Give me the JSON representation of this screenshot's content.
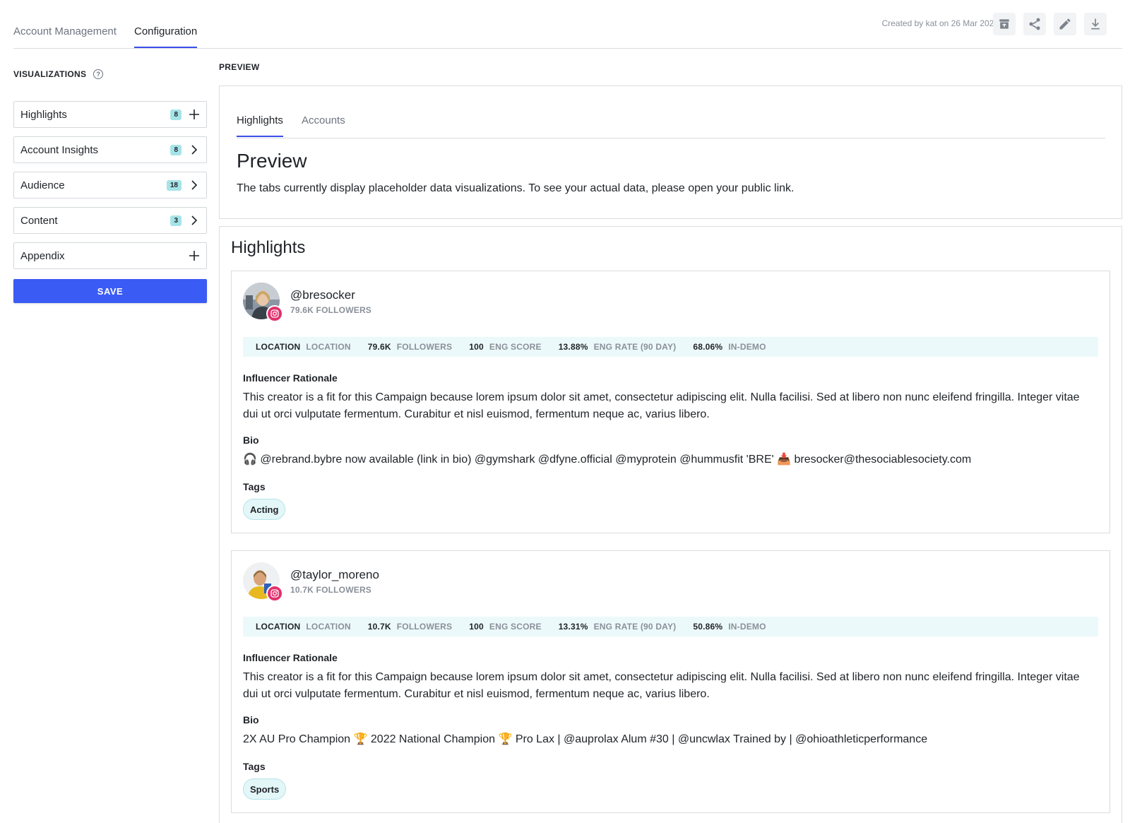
{
  "header": {
    "tabs": [
      {
        "label": "Account Management"
      },
      {
        "label": "Configuration"
      }
    ],
    "created_text": "Created by kat on 26 Mar 2025",
    "tools": [
      "archive-icon",
      "share-icon",
      "edit-icon",
      "download-icon"
    ]
  },
  "sidebar": {
    "title": "VISUALIZATIONS",
    "help": "?",
    "items": [
      {
        "label": "Highlights",
        "badge": "8",
        "action": "plus-icon"
      },
      {
        "label": "Account Insights",
        "badge": "8",
        "action": "chevron-right-icon"
      },
      {
        "label": "Audience",
        "badge": "18",
        "action": "chevron-right-icon"
      },
      {
        "label": "Content",
        "badge": "3",
        "action": "chevron-right-icon"
      },
      {
        "label": "Appendix",
        "badge": "",
        "action": "plus-icon"
      }
    ],
    "save_label": "SAVE"
  },
  "main": {
    "preview_label": "PREVIEW",
    "tabs": [
      {
        "label": "Highlights"
      },
      {
        "label": "Accounts"
      }
    ],
    "preview_heading": "Preview",
    "preview_desc": "The tabs currently display placeholder data visualizations. To see your actual data, please open your public link.",
    "highlights_heading": "Highlights",
    "influencers": [
      {
        "handle": "@bresocker",
        "followers_sub": "79.6K FOLLOWERS",
        "stats": {
          "location_val": "LOCATION",
          "location_lbl": "LOCATION",
          "followers_val": "79.6K",
          "followers_lbl": "FOLLOWERS",
          "eng_score_val": "100",
          "eng_score_lbl": "ENG SCORE",
          "eng_rate_val": "13.88%",
          "eng_rate_lbl": "ENG RATE (90 DAY)",
          "in_demo_val": "68.06%",
          "in_demo_lbl": "IN-DEMO"
        },
        "rationale_title": "Influencer Rationale",
        "rationale": "This creator is a fit for this Campaign because lorem ipsum dolor sit amet, consectetur adipiscing elit. Nulla facilisi. Sed at libero non nunc eleifend fringilla. Integer vitae dui ut orci vulputate fermentum. Curabitur et nisl euismod, fermentum neque ac, varius libero.",
        "bio_title": "Bio",
        "bio": "🎧 @rebrand.bybre now available (link in bio) @gymshark @dfyne.official @myprotein @hummusfit 'BRE' 📥 bresocker@thesociablesociety.com",
        "tags_title": "Tags",
        "tag": "Acting"
      },
      {
        "handle": "@taylor_moreno",
        "followers_sub": "10.7K FOLLOWERS",
        "stats": {
          "location_val": "LOCATION",
          "location_lbl": "LOCATION",
          "followers_val": "10.7K",
          "followers_lbl": "FOLLOWERS",
          "eng_score_val": "100",
          "eng_score_lbl": "ENG SCORE",
          "eng_rate_val": "13.31%",
          "eng_rate_lbl": "ENG RATE (90 DAY)",
          "in_demo_val": "50.86%",
          "in_demo_lbl": "IN-DEMO"
        },
        "rationale_title": "Influencer Rationale",
        "rationale": "This creator is a fit for this Campaign because lorem ipsum dolor sit amet, consectetur adipiscing elit. Nulla facilisi. Sed at libero non nunc eleifend fringilla. Integer vitae dui ut orci vulputate fermentum. Curabitur et nisl euismod, fermentum neque ac, varius libero.",
        "bio_title": "Bio",
        "bio": "2X AU Pro Champion 🏆 2022 National Champion 🏆 Pro Lax | @auprolax Alum #30 | @uncwlax Trained by | @ohioathleticperformance",
        "tags_title": "Tags",
        "tag": "Sports"
      }
    ]
  },
  "colors": {
    "accent": "#3b4ee8",
    "save_button": "#3b5bf5",
    "badge": "#a6e3e8",
    "stats_bg": "#ecf9fa",
    "instagram": "#e1306c"
  }
}
